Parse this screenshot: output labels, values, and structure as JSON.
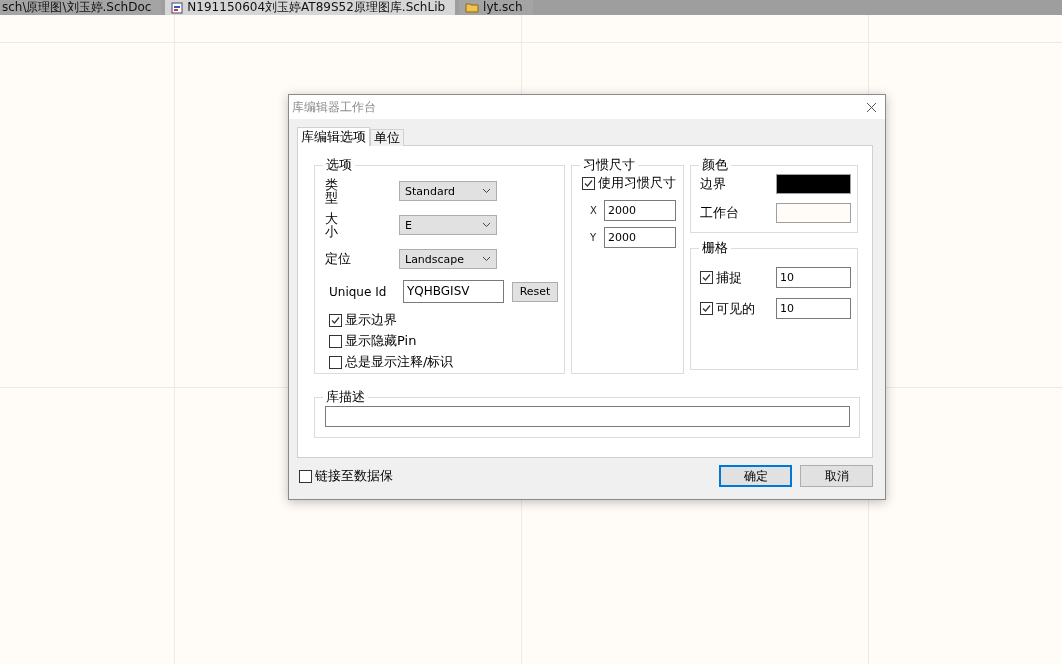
{
  "file_tabs": [
    {
      "label": "sch\\原理图\\刘玉婷.SchDoc",
      "selected": false
    },
    {
      "label": "N191150604刘玉婷AT89S52原理图库.SchLib",
      "selected": true
    },
    {
      "label": "lyt.sch",
      "selected": false
    }
  ],
  "dialog": {
    "title": "库编辑器工作台",
    "tabs": [
      {
        "label": "库编辑选项",
        "selected": true
      },
      {
        "label": "单位",
        "selected": false
      }
    ],
    "options": {
      "title": "选项",
      "selects": [
        {
          "label": "类型",
          "value": "Standard",
          "stacked": true
        },
        {
          "label": "大小",
          "value": "E",
          "stacked": true
        },
        {
          "label": "定位",
          "value": "Landscape",
          "stacked": false
        }
      ],
      "unique_id": {
        "label": "Unique Id",
        "value": "YQHBGISV",
        "button": "Reset"
      },
      "checkboxes": [
        {
          "label": "显示边界",
          "checked": true
        },
        {
          "label": "显示隐藏Pin",
          "checked": false
        },
        {
          "label": "总是显示注释/标识",
          "checked": false
        }
      ]
    },
    "custom_size": {
      "title": "习惯尺寸",
      "checkbox": {
        "label": "使用习惯尺寸",
        "checked": true
      },
      "fields": [
        {
          "label": "X",
          "value": "2000"
        },
        {
          "label": "Y",
          "value": "2000"
        }
      ]
    },
    "colors": {
      "title": "颜色",
      "items": [
        {
          "label": "边界",
          "color": "#000000"
        },
        {
          "label": "工作台",
          "color": "#fffcf7"
        }
      ]
    },
    "grid": {
      "title": "栅格",
      "items": [
        {
          "label": "捕捉",
          "checked": true,
          "value": "10"
        },
        {
          "label": "可见的",
          "checked": true,
          "value": "10"
        }
      ]
    },
    "description": {
      "title": "库描述"
    },
    "link_checkbox": {
      "label": "链接至数据保",
      "checked": false
    },
    "buttons": [
      {
        "label": "确定",
        "default": true
      },
      {
        "label": "取消",
        "default": false
      }
    ]
  }
}
